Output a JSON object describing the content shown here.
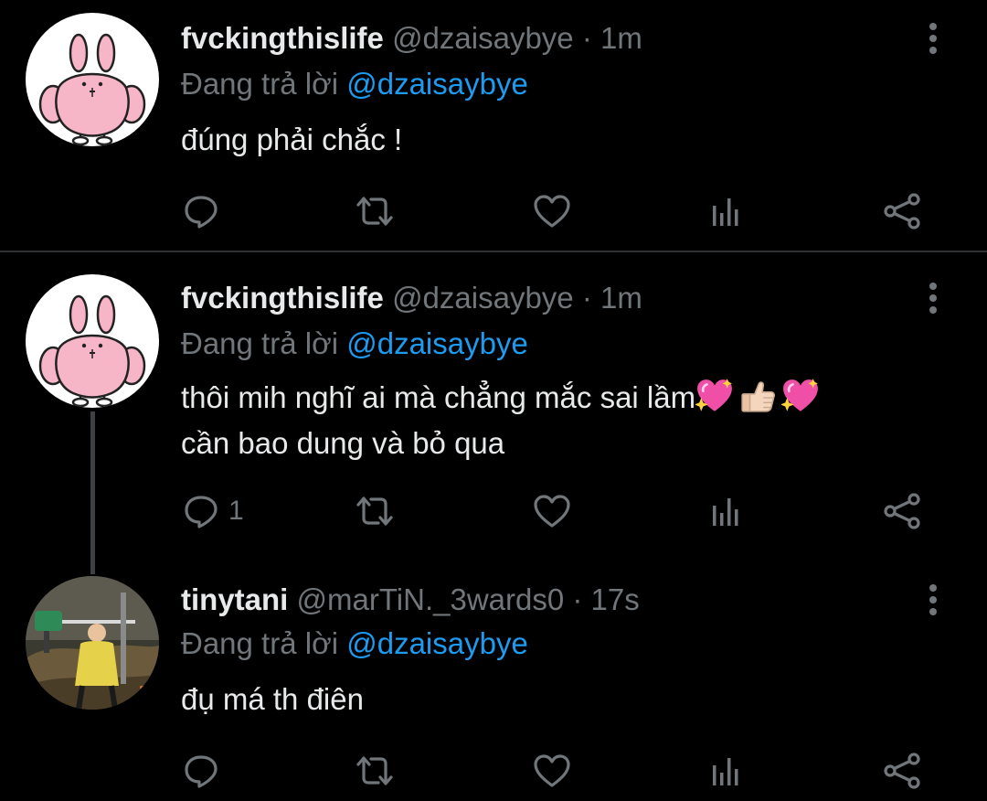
{
  "tweets": [
    {
      "name": "fvckingthislife",
      "handle": "@dzaisaybye",
      "time": "1m",
      "reply_prefix": "Đang trả lời ",
      "reply_to": "@dzaisaybye",
      "lines": [
        "đúng phải chắc !"
      ],
      "reply_count": "",
      "avatar": "bunny"
    },
    {
      "name": "fvckingthislife",
      "handle": "@dzaisaybye",
      "time": "1m",
      "reply_prefix": "Đang trả lời ",
      "reply_to": "@dzaisaybye",
      "lines": [
        "thôi mih nghĩ ai mà chẳng mắc sai lầm",
        "cần bao dung và bỏ qua"
      ],
      "emojis": [
        "sparkling-heart",
        "thumbs-up",
        "sparkling-heart"
      ],
      "reply_count": "1",
      "avatar": "bunny"
    },
    {
      "name": "tinytani",
      "handle": "@marTiN._3wards0",
      "time": "17s",
      "reply_prefix": "Đang trả lời ",
      "reply_to": "@dzaisaybye",
      "lines": [
        "đụ má th điên"
      ],
      "reply_count": "",
      "avatar": "photo"
    }
  ],
  "separator": "·",
  "icons": [
    "reply-icon",
    "retweet-icon",
    "like-icon",
    "analytics-icon",
    "share-icon",
    "more-icon"
  ],
  "colors": {
    "background": "#000000",
    "text": "#e7e9ea",
    "muted": "#71767b",
    "link": "#1d9bf0"
  }
}
